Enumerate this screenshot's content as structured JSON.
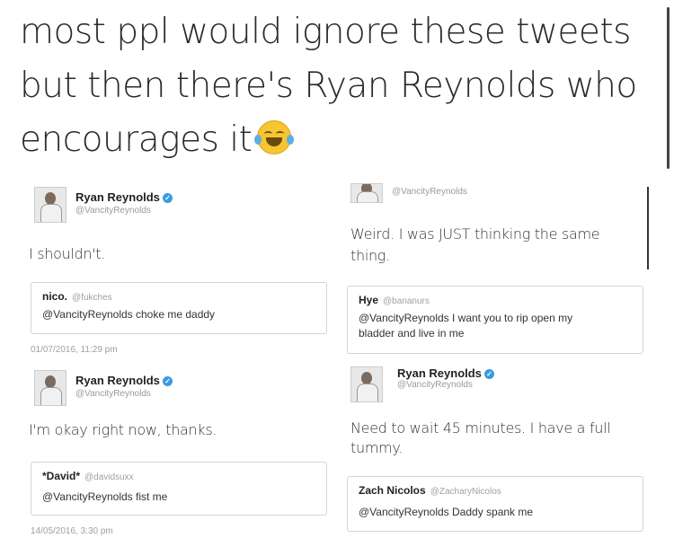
{
  "headline": {
    "line1": "most ppl would ignore these tweets",
    "line2": "but then there's Ryan Reynolds who",
    "line3": "encourages it",
    "emoji": "face-with-tears-of-joy"
  },
  "tweets": [
    {
      "user": "Ryan Reynolds",
      "handle": "@VancityReynolds",
      "reply": "I shouldn't.",
      "quote_user": "nico.",
      "quote_handle": "@fukches",
      "quote_text": "@VancityReynolds choke me daddy",
      "timestamp": "01/07/2016, 11:29 pm"
    },
    {
      "user": "",
      "handle": "@VancityReynolds",
      "reply_l1": "Weird. I was JUST thinking the same",
      "reply_l2": "thing.",
      "quote_user": "Hye",
      "quote_handle": "@bananurs",
      "quote_text_l1": "@VancityReynolds I want you to rip open my",
      "quote_text_l2": "bladder and live in me"
    },
    {
      "user": "Ryan Reynolds",
      "handle": "@VancityReynolds",
      "reply": "I'm okay right now, thanks.",
      "quote_user": "*David*",
      "quote_handle": "@davidsuxx",
      "quote_text": "@VancityReynolds fist me",
      "timestamp": "14/05/2016, 3:30 pm"
    },
    {
      "user": "Ryan Reynolds",
      "handle": "@VancityReynolds",
      "reply_l1": "Need to wait 45 minutes. I have a full",
      "reply_l2": "tummy.",
      "quote_user": "Zach Nicolos",
      "quote_handle": "@ZacharyNicolos",
      "quote_text": "@VancityReynolds Daddy spank me"
    }
  ],
  "verified_glyph": "✓"
}
